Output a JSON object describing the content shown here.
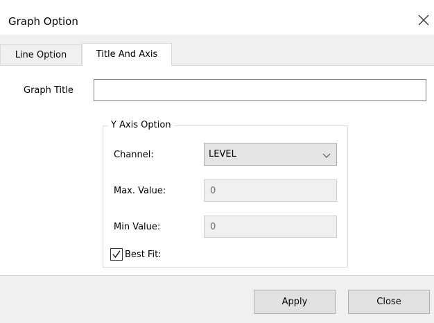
{
  "window": {
    "title": "Graph Option",
    "close_icon": "close-icon"
  },
  "tabs": [
    {
      "label": "Line Option",
      "active": false
    },
    {
      "label": "Title And Axis",
      "active": true
    }
  ],
  "form": {
    "graph_title_label": "Graph Title",
    "graph_title_value": "",
    "y_axis_group": {
      "legend": "Y Axis Option",
      "channel_label": "Channel:",
      "channel_value": "LEVEL",
      "max_label": "Max. Value:",
      "max_value": "0",
      "min_label": "Min Value:",
      "min_value": "0",
      "best_fit_label": "Best Fit:",
      "best_fit_checked": true
    }
  },
  "buttons": {
    "apply": "Apply",
    "close": "Close"
  }
}
